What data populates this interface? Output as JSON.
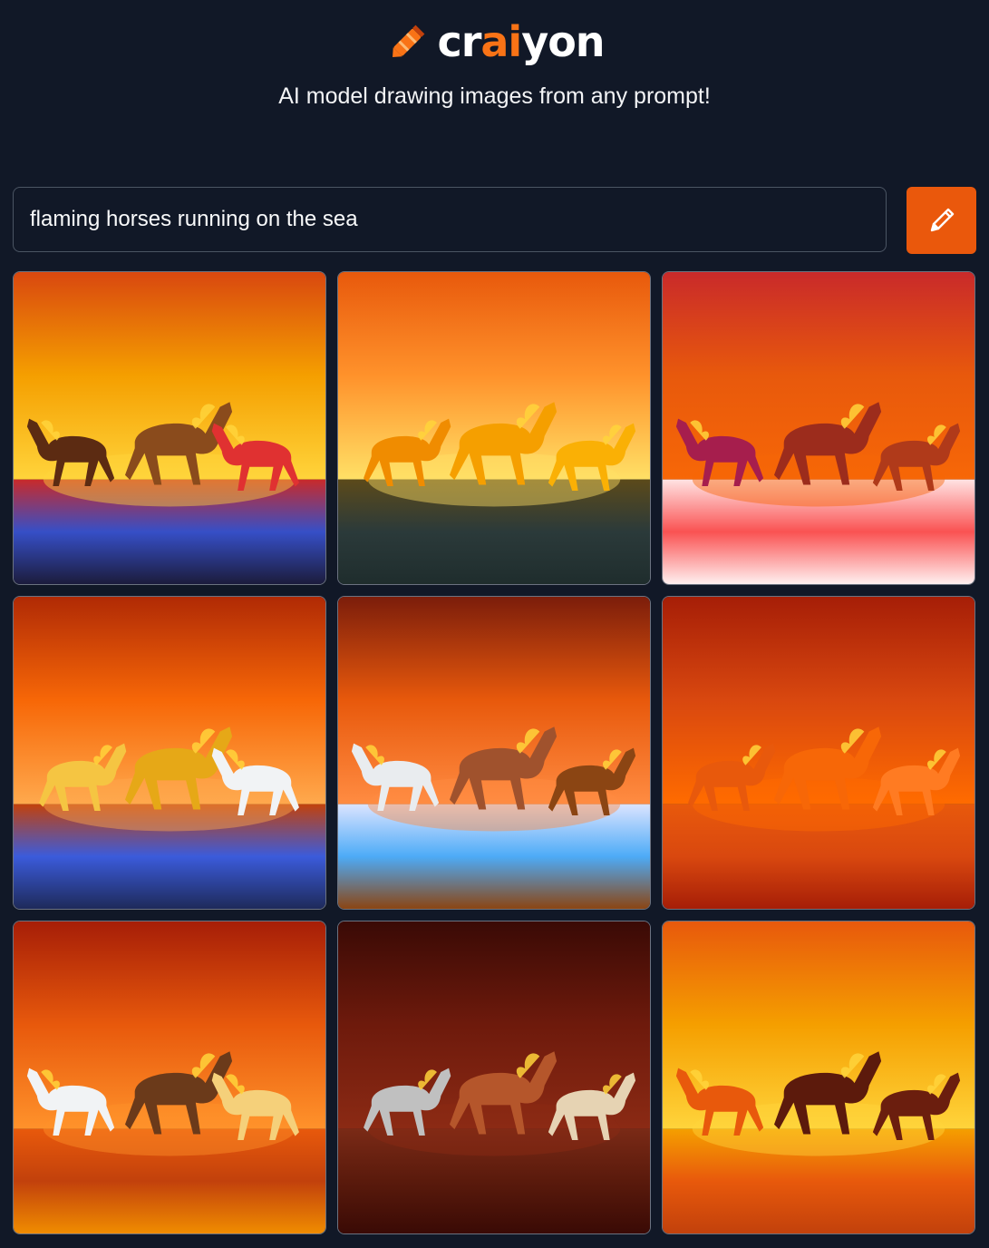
{
  "header": {
    "logo_text": {
      "part1": "cr",
      "accent": "ai",
      "part2": "yon"
    },
    "logo_icon": "crayon-icon",
    "tagline": "AI model drawing images from any prompt!"
  },
  "prompt": {
    "value": "flaming horses running on the sea",
    "draw_button_icon": "pencil-icon"
  },
  "colors": {
    "background": "#111827",
    "accent": "#ea580c",
    "text": "#ffffff"
  },
  "results": [
    {
      "sky": [
        "#d9480f",
        "#f59f00",
        "#ffd43b"
      ],
      "sea": [
        "#c92a2a",
        "#364fc7",
        "#1c1c3c"
      ],
      "horses": [
        "#5c2b12",
        "#8a4b1c",
        "#e03131"
      ]
    },
    {
      "sky": [
        "#e8590c",
        "#ff922b",
        "#ffe066"
      ],
      "sea": [
        "#5c4a1a",
        "#2b3a3a",
        "#1f2d2d"
      ],
      "horses": [
        "#f08c00",
        "#f59f00",
        "#fab005"
      ]
    },
    {
      "sky": [
        "#c92a2a",
        "#e8590c",
        "#f76707"
      ],
      "sea": [
        "#ffe3e3",
        "#fa5252",
        "#fff0f0"
      ],
      "horses": [
        "#a61e4d",
        "#9c2c1c",
        "#b03a1a"
      ]
    },
    {
      "sky": [
        "#b02a05",
        "#f76707",
        "#ffa94d"
      ],
      "sea": [
        "#c2410c",
        "#3b5bdb",
        "#1e2a5a"
      ],
      "horses": [
        "#f5c542",
        "#e6a817",
        "#f1f3f5"
      ]
    },
    {
      "sky": [
        "#7c1d0b",
        "#e8590c",
        "#ff8c42"
      ],
      "sea": [
        "#dbe4ff",
        "#4dabf7",
        "#8b4513"
      ],
      "horses": [
        "#e9ecef",
        "#a0522d",
        "#8b4513"
      ]
    },
    {
      "sky": [
        "#a61e07",
        "#d9480f",
        "#ff6b00"
      ],
      "sea": [
        "#e8590c",
        "#d9480f",
        "#a61e07"
      ],
      "horses": [
        "#e8590c",
        "#f76707",
        "#ff7b22"
      ]
    },
    {
      "sky": [
        "#a61e07",
        "#e8590c",
        "#ff922b"
      ],
      "sea": [
        "#e8590c",
        "#c2410c",
        "#f08c00"
      ],
      "horses": [
        "#f1f3f5",
        "#6b3a1a",
        "#f5d07a"
      ]
    },
    {
      "sky": [
        "#3a0a05",
        "#6e1a0c",
        "#8b2a14"
      ],
      "sea": [
        "#7a2a16",
        "#5a1a0c",
        "#3a0a05"
      ],
      "horses": [
        "#c0c0c0",
        "#b5562b",
        "#e6d3b3"
      ]
    },
    {
      "sky": [
        "#e8590c",
        "#f59f00",
        "#ffd43b"
      ],
      "sea": [
        "#f59f00",
        "#e8590c",
        "#c2410c"
      ],
      "horses": [
        "#e8590c",
        "#5c1a0c",
        "#6b1e0e"
      ]
    }
  ]
}
